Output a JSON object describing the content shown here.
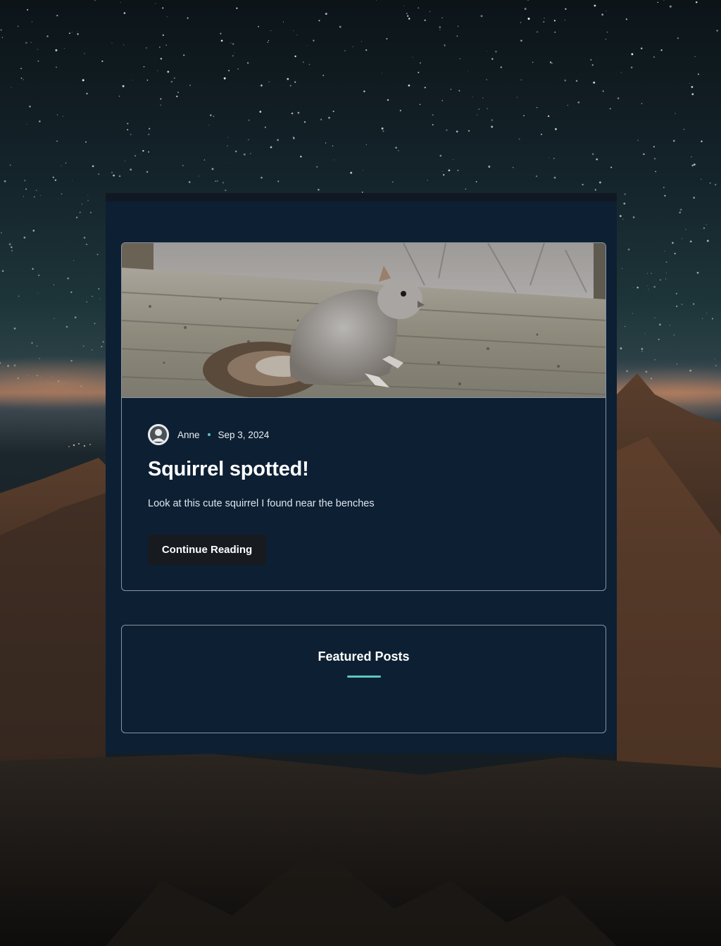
{
  "post": {
    "author": "Anne",
    "date": "Sep 3, 2024",
    "title": "Squirrel spotted!",
    "excerpt": "Look at this cute squirrel I found near the benches",
    "button_label": "Continue Reading",
    "image_subject": "squirrel-on-wooden-deck"
  },
  "featured": {
    "title": "Featured Posts"
  },
  "colors": {
    "panel_bg": "#0d1f33",
    "border": "#8894a0",
    "accent": "#5cc8c0",
    "button_bg": "#171b20"
  },
  "icons": {
    "avatar": "user-avatar-icon"
  }
}
